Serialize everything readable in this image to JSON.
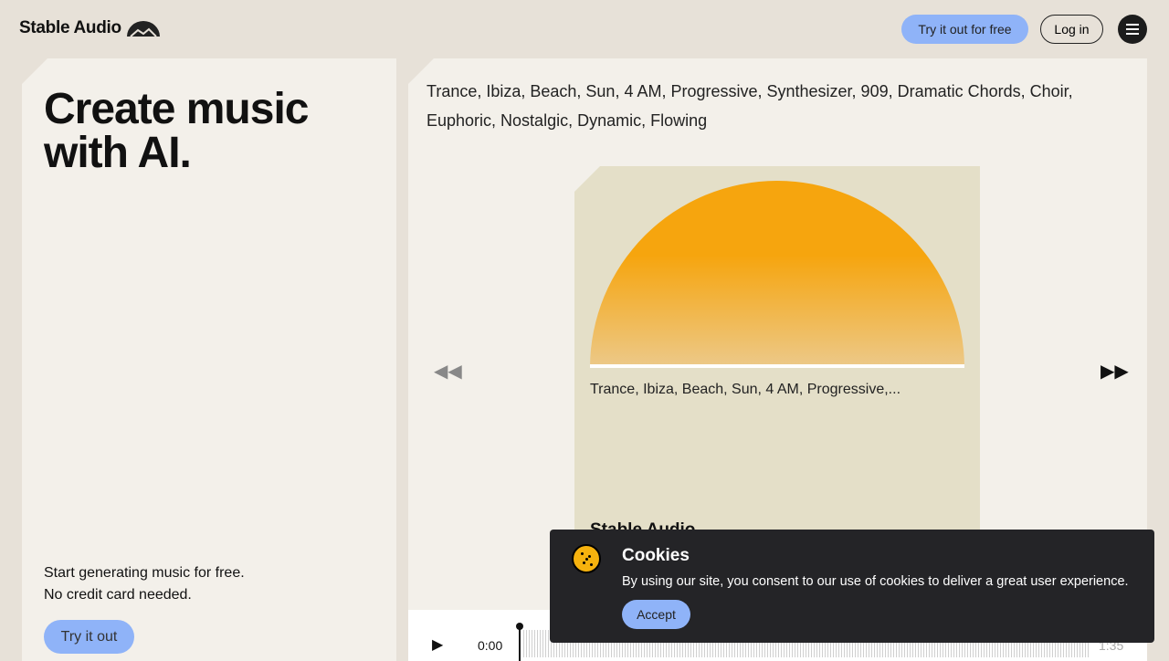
{
  "header": {
    "logo": "Stable Audio",
    "try_free": "Try it out for free",
    "login": "Log in"
  },
  "hero": {
    "title": "Create music with AI.",
    "sub1": "Start generating music for free.",
    "sub2": "No credit card needed.",
    "cta": "Try it out"
  },
  "player": {
    "prompt": "Trance, Ibiza, Beach, Sun, 4 AM, Progressive, Synthesizer, 909, Dramatic Chords, Choir, Euphoric, Nostalgic, Dynamic, Flowing",
    "card_caption": "Trance, Ibiza, Beach, Sun, 4 AM, Progressive,...",
    "card_brand": "Stable Audio",
    "current_time": "0:00",
    "end_time": "1:35",
    "progress": 0
  },
  "cookies": {
    "title": "Cookies",
    "text": "By using our site, you consent to our use of cookies to deliver a great user experience.",
    "accept": "Accept"
  }
}
